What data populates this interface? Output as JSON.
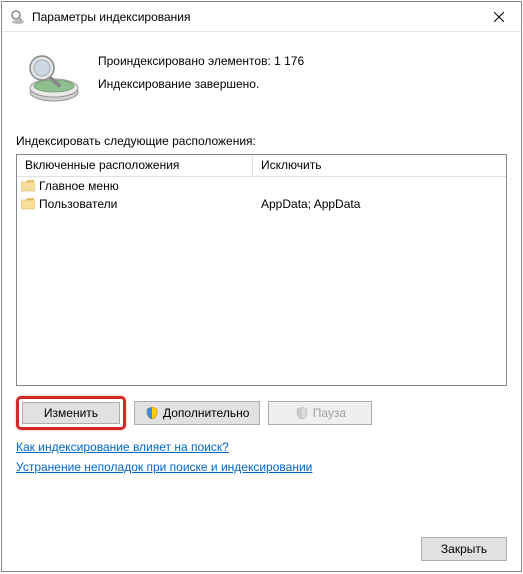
{
  "window": {
    "title": "Параметры индексирования"
  },
  "status": {
    "line1": "Проиндексировано элементов: 1 176",
    "line2": "Индексирование завершено."
  },
  "section_label": "Индексировать следующие расположения:",
  "columns": {
    "included": "Включенные расположения",
    "excluded": "Исключить"
  },
  "rows": [
    {
      "included": "Главное меню",
      "excluded": ""
    },
    {
      "included": "Пользователи",
      "excluded": "AppData; AppData"
    }
  ],
  "buttons": {
    "modify": "Изменить",
    "advanced": "Дополнительно",
    "pause": "Пауза",
    "close": "Закрыть"
  },
  "links": {
    "help1": "Как индексирование влияет на поиск?",
    "help2": "Устранение неполадок при поиске и индексировании"
  }
}
